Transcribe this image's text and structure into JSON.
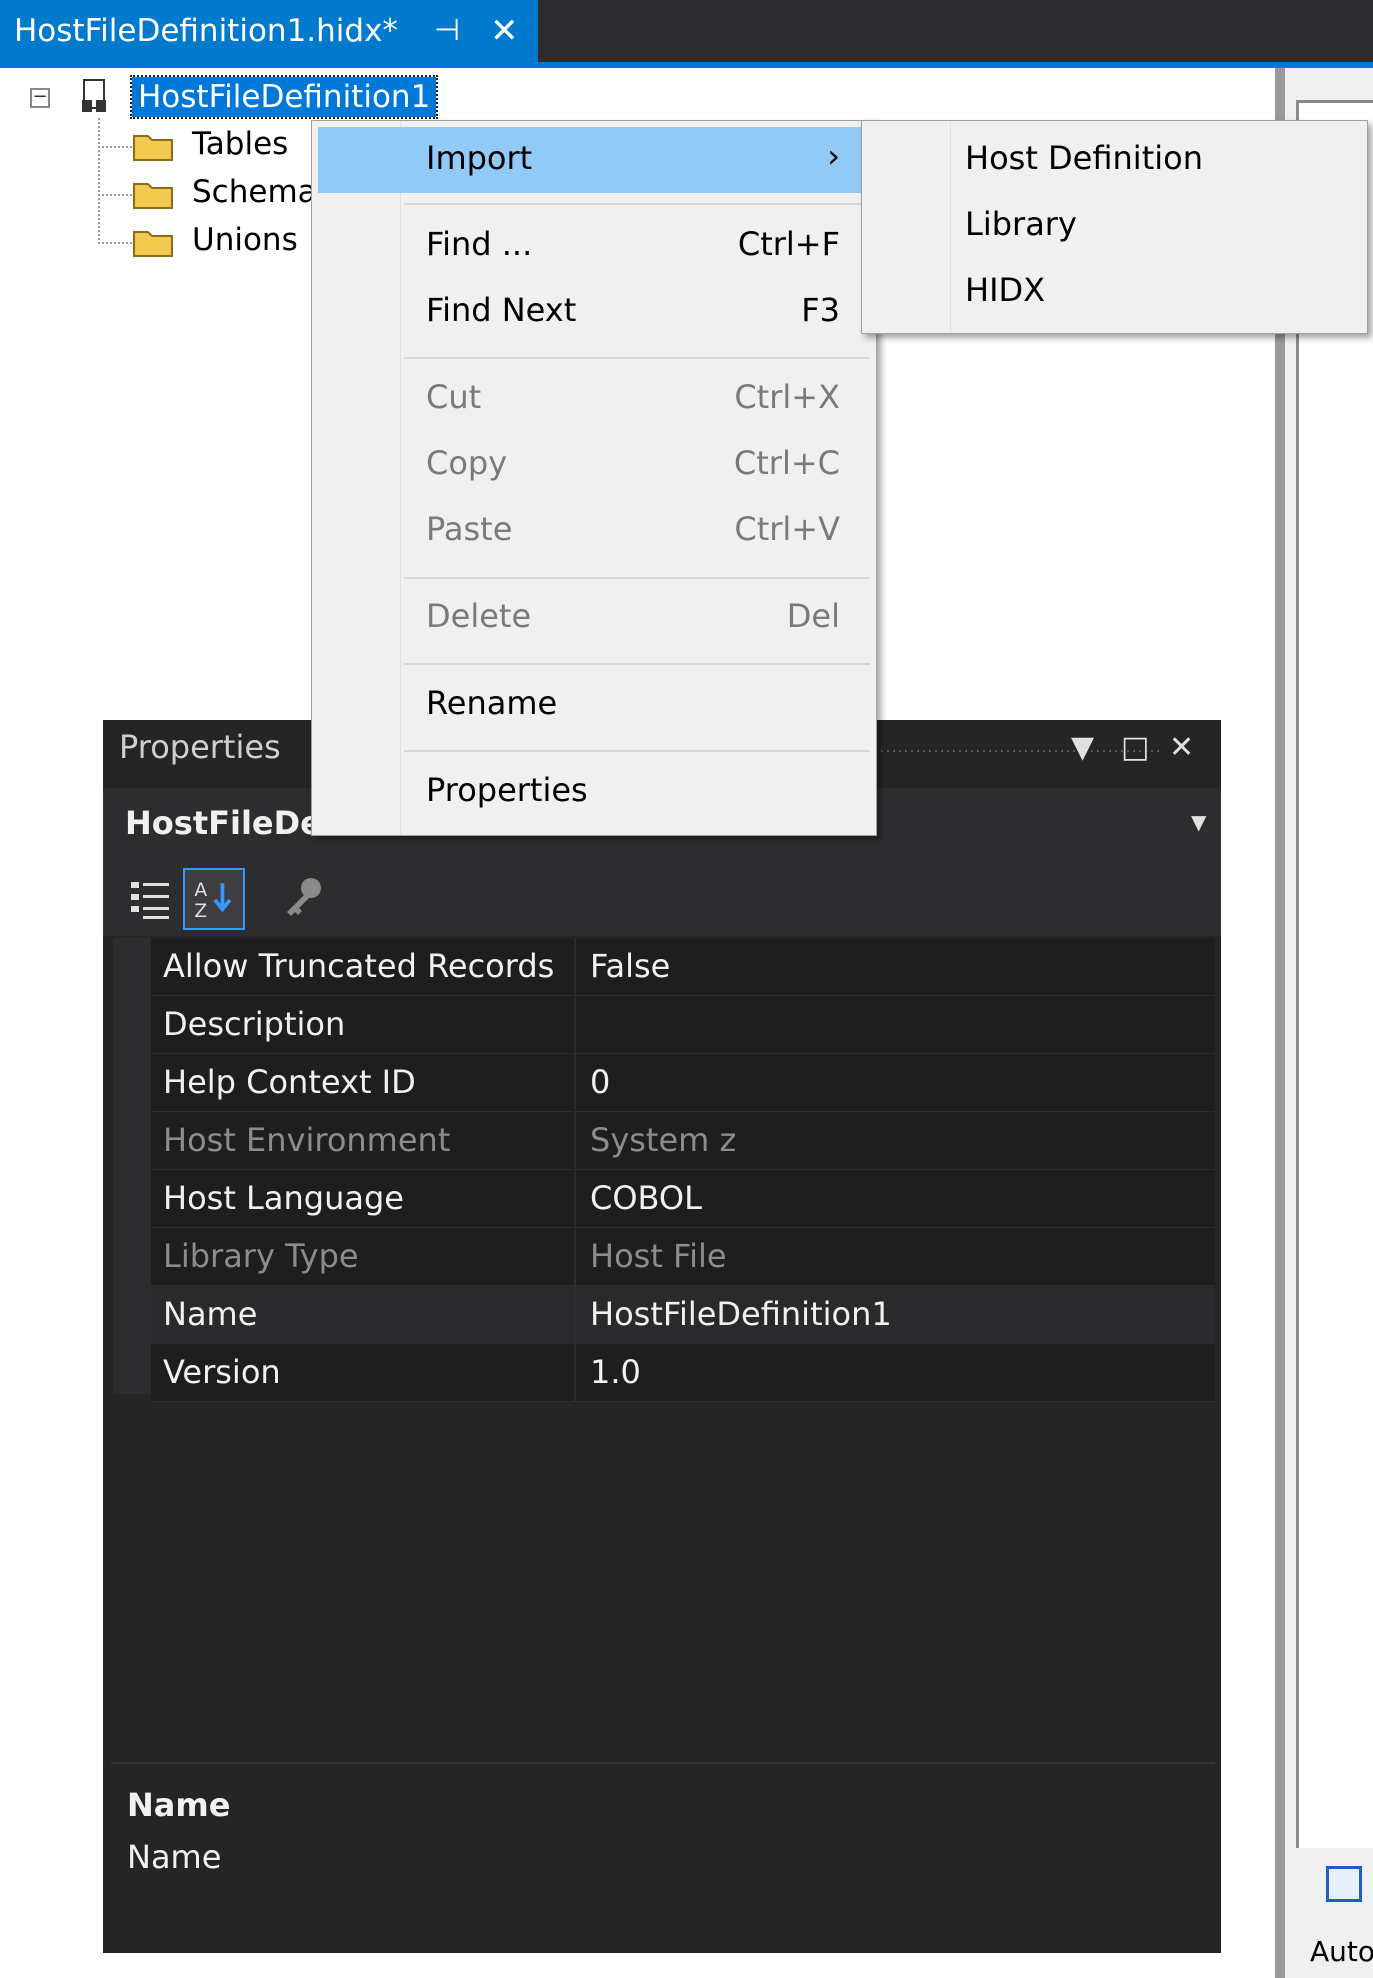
{
  "tab": {
    "title": "HostFileDefinition1.hidx*",
    "pin": "⊣",
    "close": "✕"
  },
  "tree": {
    "root": "HostFileDefinition1",
    "children": [
      "Tables",
      "Schema",
      "Unions"
    ]
  },
  "context_menu": {
    "import": "Import",
    "find": "Find ...",
    "find_key": "Ctrl+F",
    "find_next": "Find Next",
    "find_next_key": "F3",
    "cut": "Cut",
    "cut_key": "Ctrl+X",
    "copy": "Copy",
    "copy_key": "Ctrl+C",
    "paste": "Paste",
    "paste_key": "Ctrl+V",
    "delete": "Delete",
    "delete_key": "Del",
    "rename": "Rename",
    "properties": "Properties"
  },
  "submenu": {
    "items": [
      "Host Definition",
      "Library",
      "HIDX"
    ]
  },
  "properties": {
    "title": "Properties",
    "object": "HostFileDefinition1",
    "rows": [
      {
        "name": "Allow Truncated Records",
        "value": "False",
        "readonly": false
      },
      {
        "name": "Description",
        "value": "",
        "readonly": false
      },
      {
        "name": "Help Context ID",
        "value": "0",
        "readonly": false
      },
      {
        "name": "Host Environment",
        "value": "System z",
        "readonly": true
      },
      {
        "name": "Host Language",
        "value": "COBOL",
        "readonly": false
      },
      {
        "name": "Library Type",
        "value": "Host File",
        "readonly": true
      },
      {
        "name": "Name",
        "value": "HostFileDefinition1",
        "readonly": false
      },
      {
        "name": "Version",
        "value": "1.0",
        "readonly": false
      }
    ],
    "desc_title": "Name",
    "desc_text": "Name"
  },
  "right_panel": {
    "label": "Auto"
  },
  "colors": {
    "accent": "#007acc",
    "menu_highlight": "#91c9f7",
    "tree_selection": "#0078d7"
  }
}
